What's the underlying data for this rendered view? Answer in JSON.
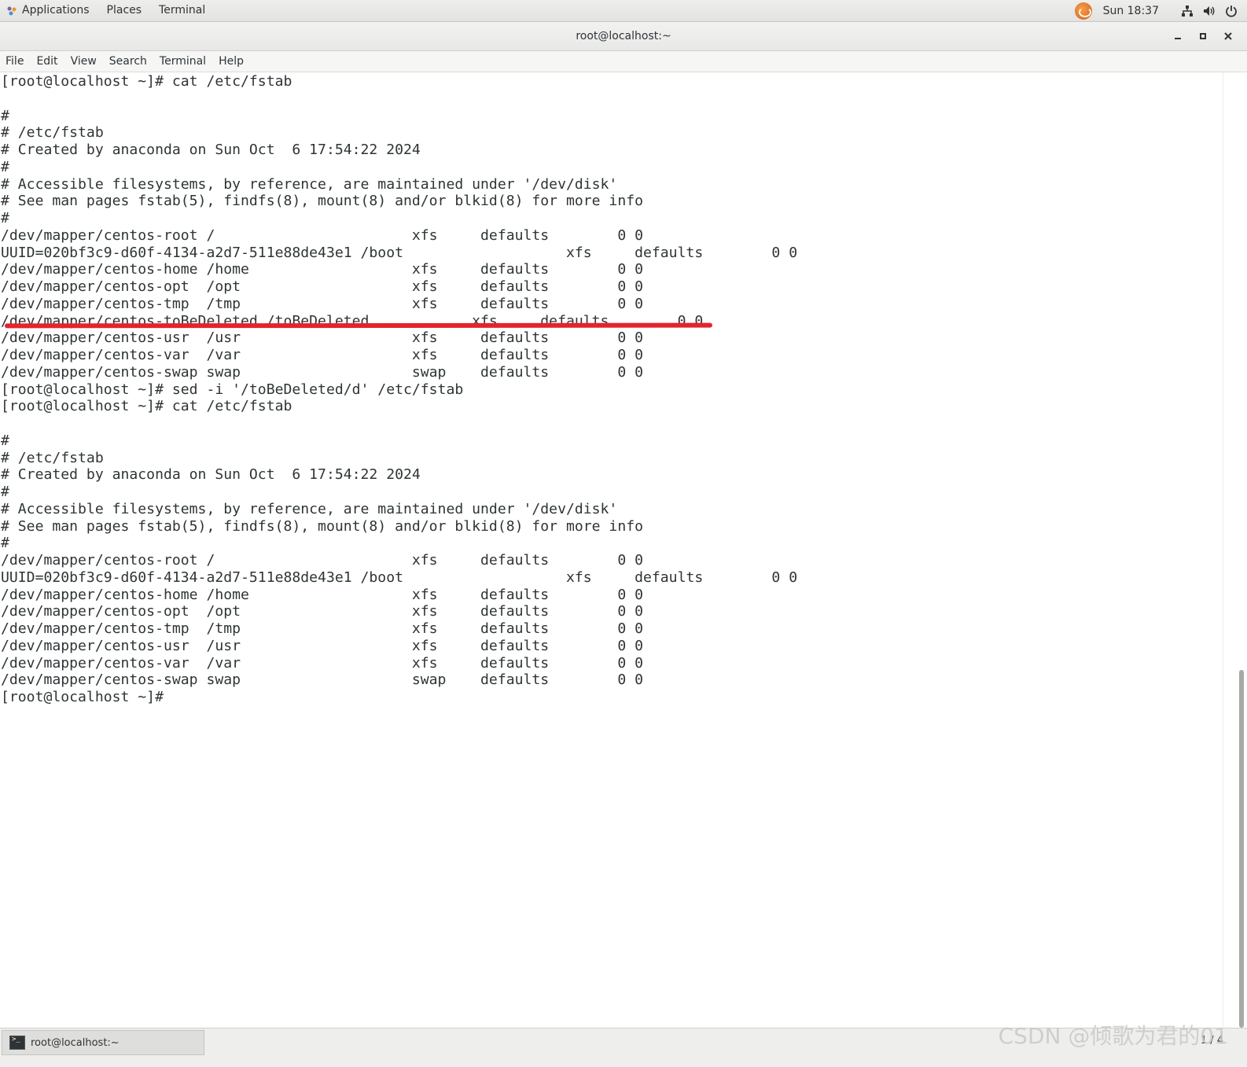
{
  "top_panel": {
    "applications": "Applications",
    "places": "Places",
    "terminal": "Terminal",
    "clock": "Sun 18:37"
  },
  "window": {
    "title": "root@localhost:~"
  },
  "menubar": {
    "items": [
      "File",
      "Edit",
      "View",
      "Search",
      "Terminal",
      "Help"
    ]
  },
  "terminal": {
    "lines": [
      "[root@localhost ~]# cat /etc/fstab",
      "",
      "#",
      "# /etc/fstab",
      "# Created by anaconda on Sun Oct  6 17:54:22 2024",
      "#",
      "# Accessible filesystems, by reference, are maintained under '/dev/disk'",
      "# See man pages fstab(5), findfs(8), mount(8) and/or blkid(8) for more info",
      "#",
      "/dev/mapper/centos-root /                       xfs     defaults        0 0",
      "UUID=020bf3c9-d60f-4134-a2d7-511e88de43e1 /boot                   xfs     defaults        0 0",
      "/dev/mapper/centos-home /home                   xfs     defaults        0 0",
      "/dev/mapper/centos-opt  /opt                    xfs     defaults        0 0",
      "/dev/mapper/centos-tmp  /tmp                    xfs     defaults        0 0",
      "/dev/mapper/centos-toBeDeleted /toBeDeleted            xfs     defaults        0 0",
      "/dev/mapper/centos-usr  /usr                    xfs     defaults        0 0",
      "/dev/mapper/centos-var  /var                    xfs     defaults        0 0",
      "/dev/mapper/centos-swap swap                    swap    defaults        0 0",
      "[root@localhost ~]# sed -i '/toBeDeleted/d' /etc/fstab",
      "[root@localhost ~]# cat /etc/fstab",
      "",
      "#",
      "# /etc/fstab",
      "# Created by anaconda on Sun Oct  6 17:54:22 2024",
      "#",
      "# Accessible filesystems, by reference, are maintained under '/dev/disk'",
      "# See man pages fstab(5), findfs(8), mount(8) and/or blkid(8) for more info",
      "#",
      "/dev/mapper/centos-root /                       xfs     defaults        0 0",
      "UUID=020bf3c9-d60f-4134-a2d7-511e88de43e1 /boot                   xfs     defaults        0 0",
      "/dev/mapper/centos-home /home                   xfs     defaults        0 0",
      "/dev/mapper/centos-opt  /opt                    xfs     defaults        0 0",
      "/dev/mapper/centos-tmp  /tmp                    xfs     defaults        0 0",
      "/dev/mapper/centos-usr  /usr                    xfs     defaults        0 0",
      "/dev/mapper/centos-var  /var                    xfs     defaults        0 0",
      "/dev/mapper/centos-swap swap                    swap    defaults        0 0",
      "[root@localhost ~]#"
    ]
  },
  "taskbar": {
    "task_label": "root@localhost:~",
    "workspace": "1 / 4"
  },
  "watermark": "CSDN @倾歌为君的01",
  "colors": {
    "annotation": "#e3242b",
    "terminal_fg": "#2e3436",
    "terminal_bg": "#ffffff"
  }
}
